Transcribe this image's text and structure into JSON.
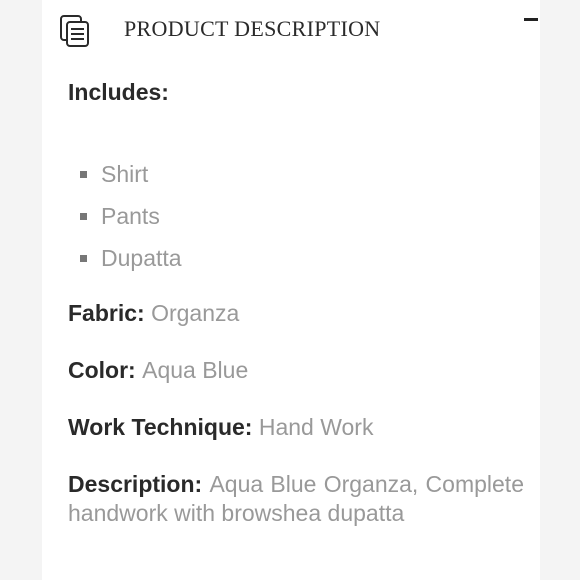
{
  "header": {
    "title": "PRODUCT DESCRIPTION",
    "collapse_label": "−"
  },
  "includes": {
    "label": "Includes:",
    "items": [
      "Shirt",
      "Pants",
      "Dupatta"
    ]
  },
  "fabric": {
    "label": "Fabric:",
    "value": "Organza"
  },
  "color": {
    "label": "Color:",
    "value": "Aqua Blue"
  },
  "work_technique": {
    "label": "Work Technique:",
    "value": "Hand Work"
  },
  "description": {
    "label": "Description:",
    "value": "Aqua Blue Organza, Complete handwork with browshea dupatta"
  }
}
